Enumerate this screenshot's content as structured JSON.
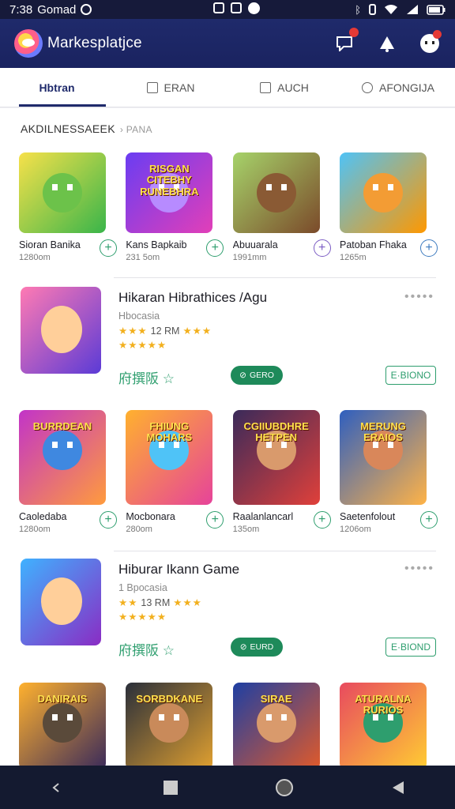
{
  "status_bar": {
    "time": "7:38",
    "carrier": "Gomad"
  },
  "header": {
    "app_title": "Markesplatjce"
  },
  "tabs": [
    {
      "label": "Hbtran",
      "icon": "home-icon",
      "active": true
    },
    {
      "label": "ERAN",
      "icon": "grid-icon",
      "active": false
    },
    {
      "label": "AUCH",
      "icon": "edit-icon",
      "active": false
    },
    {
      "label": "AFONGIJA",
      "icon": "info-icon",
      "active": false
    }
  ],
  "section": {
    "title": "AKDILNESSAEEK",
    "subtitle": "› PANA"
  },
  "row1": [
    {
      "name": "Sioran Banika",
      "size": "1280om",
      "thumb_text": "",
      "bg1": "#f7e14a",
      "bg2": "#39b54a",
      "face": "#6cc24a",
      "btn": "green"
    },
    {
      "name": "Kans Bapkaib",
      "size": "231 5om",
      "thumb_text": "RISGAN CITEBHY RUNEBHRA",
      "bg1": "#6a3df2",
      "bg2": "#e23fb8",
      "face": "#b78bff",
      "btn": "green"
    },
    {
      "name": "Abuuarala",
      "size": "1991mm",
      "thumb_text": "",
      "bg1": "#a6d36a",
      "bg2": "#7b4a2a",
      "face": "#8a5a34",
      "btn": "purple"
    },
    {
      "name": "Patoban Fhaka",
      "size": "1265m",
      "thumb_text": "",
      "bg1": "#4fc3f7",
      "bg2": "#ff9800",
      "face": "#f39c34",
      "btn": "blue"
    }
  ],
  "feature1": {
    "title": "Hikaran Hibrathices /Agu",
    "subtitle": "Hbocasia",
    "rating_text": "12 RM",
    "stars_left": "★★★",
    "stars_right": "★★★",
    "stars_second": "★★★★★",
    "tag": "府撰阪 ☆",
    "install_label": "GERO",
    "open_label": "E·BIONO",
    "thumb_bg1": "#ff7ab3",
    "thumb_bg2": "#5b3bd6"
  },
  "row2": [
    {
      "name": "Caoledaba",
      "size": "1280om",
      "thumb_text": "BURRDEAN",
      "bg1": "#c234c8",
      "bg2": "#ff9b3d",
      "face": "#3f88e0",
      "btn": "green"
    },
    {
      "name": "Mocbonara",
      "size": "280om",
      "thumb_text": "FHIUNG MOHARS",
      "bg1": "#ffb12e",
      "bg2": "#e6439a",
      "face": "#4fc3f7",
      "btn": "green"
    },
    {
      "name": "Raalanlancarl",
      "size": "135om",
      "thumb_text": "CGIIUBDHRE HETPEN",
      "bg1": "#3a2a5a",
      "bg2": "#e0403a",
      "face": "#d99a6c",
      "btn": "green"
    },
    {
      "name": "Saetenfolout",
      "size": "1206om",
      "thumb_text": "MERUNG ERAIOS",
      "bg1": "#2f5fbf",
      "bg2": "#ffb347",
      "face": "#d9875a",
      "btn": "green"
    }
  ],
  "feature2": {
    "title": "Hiburar Ikann Game",
    "subtitle": "1 Bpocasia",
    "rating_text": "13 RM",
    "stars_left": "★★",
    "stars_right": "★★★",
    "stars_second": "★★★★★",
    "tag": "府撰阪 ☆",
    "install_label": "EURD",
    "open_label": "E·BIOND",
    "thumb_bg1": "#3fb2ff",
    "thumb_bg2": "#8a2cc4"
  },
  "row3": [
    {
      "thumb_text": "DANIRAIS",
      "bg1": "#ffb12e",
      "bg2": "#3a2a5a",
      "face": "#5a4a3a"
    },
    {
      "thumb_text": "SORBDKANE",
      "bg1": "#2a2f3a",
      "bg2": "#e0a030",
      "face": "#c98a5a"
    },
    {
      "thumb_text": "SIRAE",
      "bg1": "#1e3fa3",
      "bg2": "#e05a2a",
      "face": "#d99a6c"
    },
    {
      "thumb_text": "ATURALNA RURIOS",
      "bg1": "#e84a5f",
      "bg2": "#ffcc33",
      "face": "#2e9e6e"
    }
  ],
  "colors": {
    "header_bg": "#1f2a6b",
    "accent_green": "#2e9e6e",
    "nav_bg": "#141a30"
  }
}
